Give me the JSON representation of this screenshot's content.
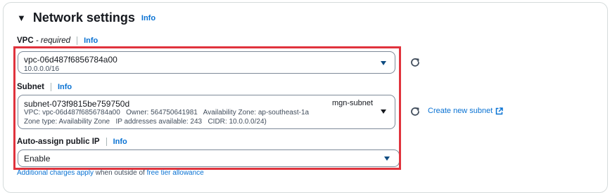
{
  "section": {
    "title": "Network settings",
    "info": "Info"
  },
  "vpc": {
    "label": "VPC",
    "required": "- required",
    "info": "Info",
    "selected_id": "vpc-06d487f6856784a00",
    "cidr": "10.0.0.0/16"
  },
  "subnet": {
    "label": "Subnet",
    "info": "Info",
    "selected_id": "subnet-073f9815be759750d",
    "name_tag": "mgn-subnet",
    "detail_line1": "VPC: vpc-06d487f6856784a00   Owner: 564750641981   Availability Zone: ap-southeast-1a",
    "detail_line2": "Zone type: Availability Zone   IP addresses available: 243   CIDR: 10.0.0.0/24)",
    "create_link": "Create new subnet"
  },
  "public_ip": {
    "label": "Auto-assign public IP",
    "info": "Info",
    "value": "Enable"
  },
  "footnote": {
    "link1": "Additional charges apply",
    "text": " when outside of ",
    "link2": "free tier allowance"
  },
  "colors": {
    "accent": "#0972d3",
    "highlight": "#e0333d"
  }
}
